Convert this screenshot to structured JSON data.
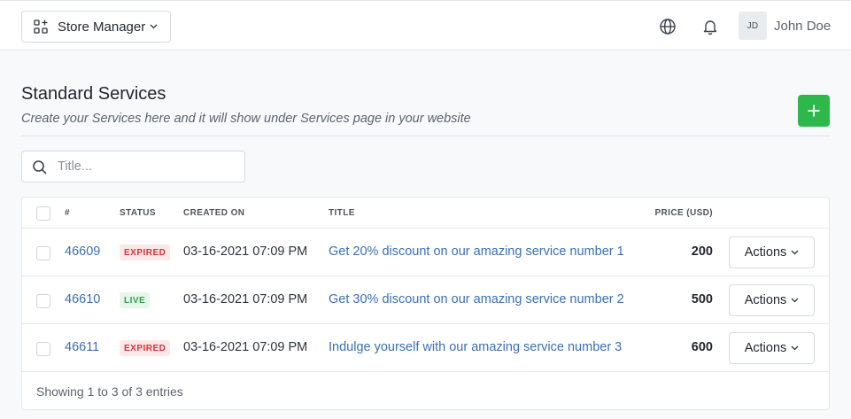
{
  "topbar": {
    "store_label": "Store Manager",
    "avatar_initials": "JD",
    "username": "John Doe"
  },
  "page": {
    "title": "Standard Services",
    "subtitle": "Create your Services here and it will show under Services page in your website"
  },
  "search": {
    "placeholder": "Title...",
    "value": ""
  },
  "table": {
    "headers": {
      "id": "#",
      "status": "STATUS",
      "created": "CREATED ON",
      "title": "TITLE",
      "price": "PRICE (USD)"
    },
    "rows": [
      {
        "id": "46609",
        "status": "EXPIRED",
        "created": "03-16-2021 07:09 PM",
        "title": "Get 20% discount on our amazing service number 1",
        "price": "200",
        "action_label": "Actions"
      },
      {
        "id": "46610",
        "status": "LIVE",
        "created": "03-16-2021 07:09 PM",
        "title": "Get 30% discount on our amazing service number 2",
        "price": "500",
        "action_label": "Actions"
      },
      {
        "id": "46611",
        "status": "EXPIRED",
        "created": "03-16-2021 07:09 PM",
        "title": "Indulge yourself with our amazing service number 3",
        "price": "600",
        "action_label": "Actions"
      }
    ],
    "footer": "Showing 1 to 3 of 3 entries"
  },
  "icons": {
    "store": "grid-plus-icon",
    "globe": "globe-icon",
    "bell": "bell-icon",
    "add": "plus-icon",
    "search": "search-icon"
  },
  "colors": {
    "accent_link": "#3b6fb6",
    "add_button": "#2eb84b",
    "expired_badge": "#d1323a",
    "live_badge": "#2ea34b"
  }
}
